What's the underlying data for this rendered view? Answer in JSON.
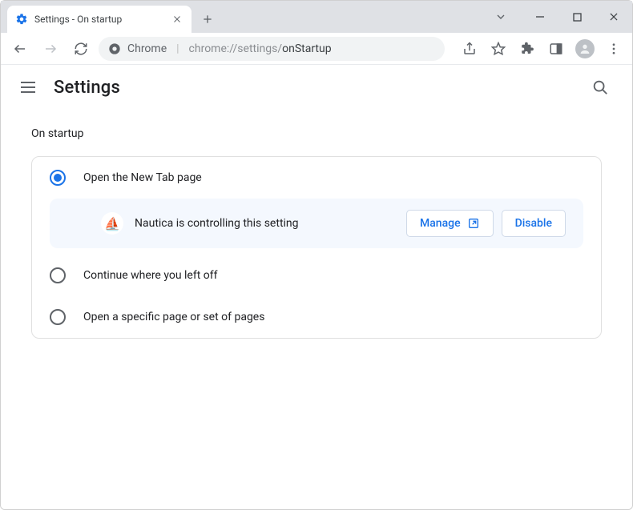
{
  "window": {
    "tab_title": "Settings - On startup"
  },
  "omnibox": {
    "prefix": "Chrome",
    "path_prefix": "chrome://settings/",
    "path_suffix": "onStartup"
  },
  "header": {
    "title": "Settings"
  },
  "section": {
    "label": "On startup",
    "options": [
      {
        "label": "Open the New Tab page",
        "checked": true
      },
      {
        "label": "Continue where you left off",
        "checked": false
      },
      {
        "label": "Open a specific page or set of pages",
        "checked": false
      }
    ],
    "notice": {
      "icon": "⛵",
      "text": "Nautica is controlling this setting",
      "manage_label": "Manage",
      "disable_label": "Disable"
    }
  }
}
